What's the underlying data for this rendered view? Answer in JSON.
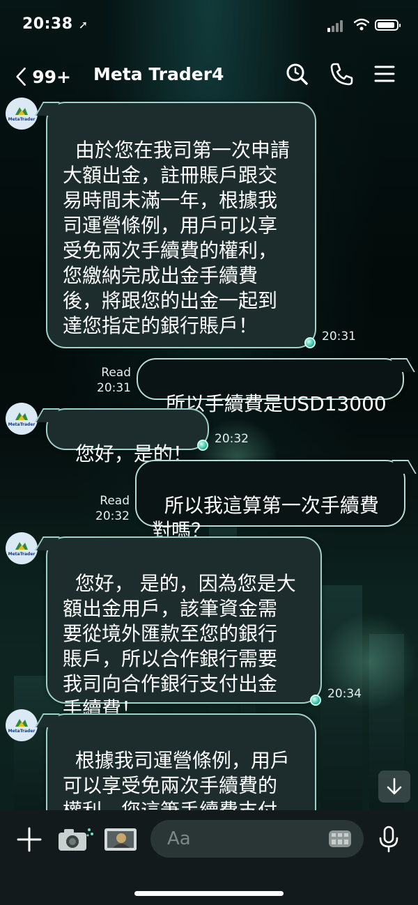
{
  "status_bar": {
    "time": "20:38",
    "location_glyph": "➚"
  },
  "header": {
    "back_count": "99+",
    "title": "Meta Trader4",
    "icons": [
      "search-icon",
      "phone-icon",
      "menu-icon"
    ]
  },
  "avatar_brand": "MetaTrader",
  "messages": [
    {
      "id": "m1",
      "direction": "in",
      "text": "由於您在我司第一次申請\n大額出金，註冊賬戶跟交\n易時間未滿一年，根據我\n司運營條例，用戶可以享\n受免兩次手續費的權利，\n您繳納完成出金手續費\n後，將跟您的出金一起到\n達您指定的銀行賬戶！",
      "time": "20:31"
    },
    {
      "id": "m2",
      "direction": "out",
      "text": "所以手續費是USD13000",
      "read": "Read",
      "time": "20:31"
    },
    {
      "id": "m3",
      "direction": "in",
      "text": "您好，是的！",
      "time": "20:32"
    },
    {
      "id": "m4",
      "direction": "out",
      "text": "所以我這算第一次手續費\n對嗎？",
      "read": "Read",
      "time": "20:32"
    },
    {
      "id": "m5",
      "direction": "in",
      "text": "您好， 是的，因為您是大\n額出金用戶，該筆資金需\n要從境外匯款至您的銀行\n賬戶，所以合作銀行需要\n我司向合作銀行支付出金\n手續費！",
      "time": "20:34"
    },
    {
      "id": "m6",
      "direction": "in",
      "text": "根據我司運營條例，用戶\n可以享受免兩次手續費的\n權利，您這筆手續費支付\n完成是可以退回到您的銀"
    }
  ],
  "composer": {
    "placeholder": "Aa"
  },
  "colors": {
    "bubble_border": "#9fd2c8",
    "bubble_bg": "#1d2d2d",
    "footer_bg": "#121a1b"
  }
}
